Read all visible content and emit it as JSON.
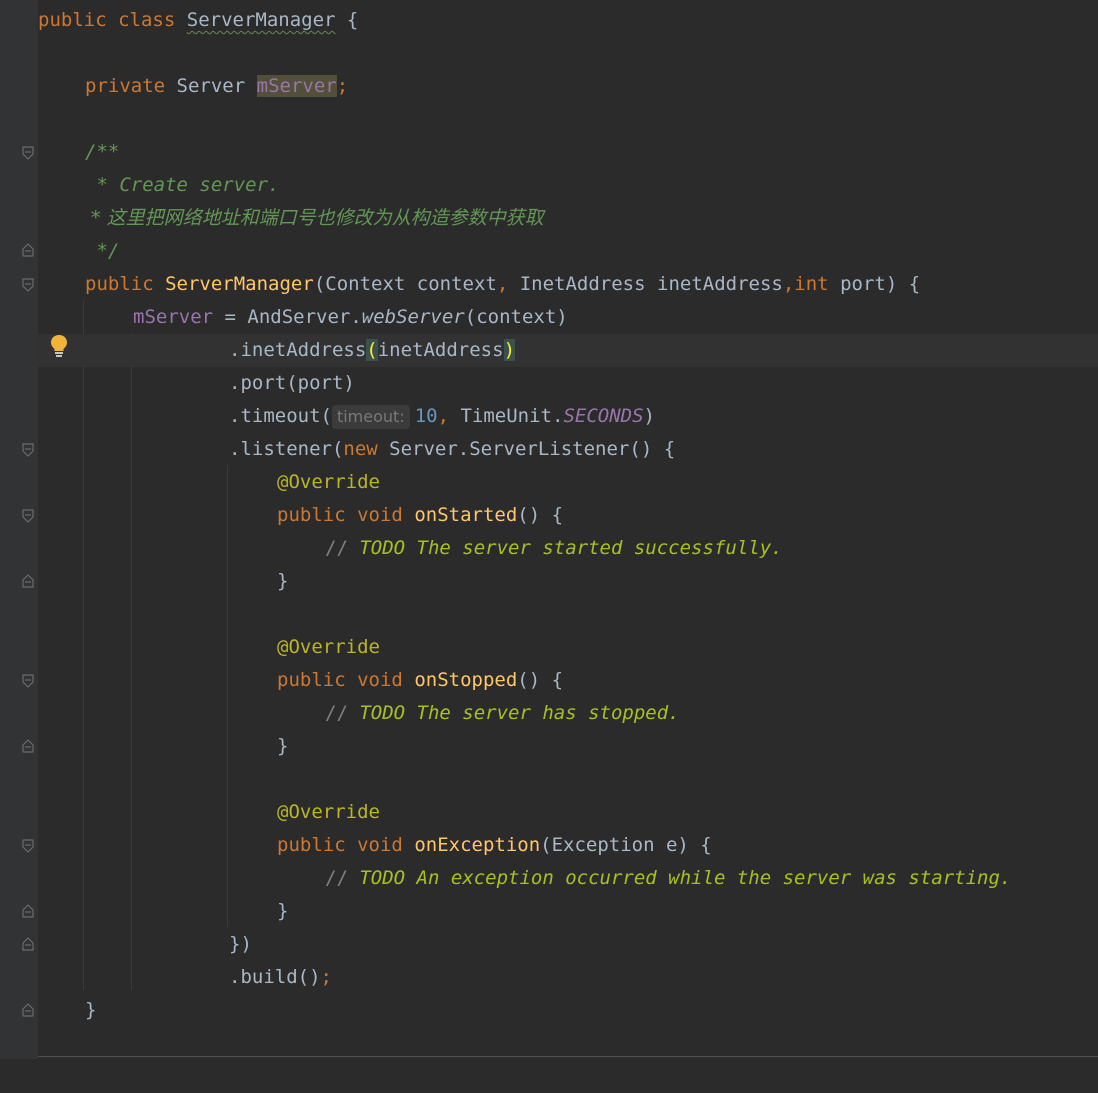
{
  "code": {
    "l01_kw1": "public",
    "l01_kw2": "class",
    "l01_name": "ServerManager",
    "l01_brace": "{",
    "l02_kw": "private",
    "l02_type": "Server",
    "l02_field": "mServer",
    "l02_semi": ";",
    "l03_open": "/**",
    "l04": " * Create server.",
    "l05": " * 这里把网络地址和端口号也修改为从构造参数中获取",
    "l06": " */",
    "l07_kw": "public",
    "l07_name": "ServerManager",
    "l07_p1": "(Context context",
    "l07_c1": ",",
    "l07_p2": " InetAddress inetAddress",
    "l07_c2": ",",
    "l07_kw2": "int",
    "l07_p3": " port) {",
    "l08_field": "mServer",
    "l08_eq": " = AndServer.",
    "l08_method": "webServer",
    "l08_rest": "(context)",
    "l09_a": ".inetAddress",
    "l09_open": "(",
    "l09_arg": "inetAddress",
    "l09_close": ")",
    "l10": ".port(port)",
    "l11_a": ".timeout(",
    "l11_hint": "timeout:",
    "l11_num": "10",
    "l11_comma": ",",
    "l11_b": " TimeUnit.",
    "l11_const": "SECONDS",
    "l11_c": ")",
    "l12_a": ".listener(",
    "l12_kw": "new",
    "l12_b": " Server.ServerListener() {",
    "override": "@Override",
    "kw_public": "public",
    "kw_void": "void",
    "l14_name": "onStarted",
    "l14_rest": "() {",
    "slashes": "//",
    "l15_todo": " TODO The server started successfully.",
    "close_brace": "}",
    "l19_name": "onStopped",
    "l19_rest": "() {",
    "l20_todo": " TODO The server has stopped.",
    "l24_name": "onException",
    "l24_rest": "(Exception e) {",
    "l25_todo": " TODO An exception occurred while the server was starting.",
    "l27": "})",
    "l28_a": ".build()",
    "l28_semi": ";",
    "l29": "}"
  },
  "colors": {
    "background": "#2b2b2b",
    "keyword": "#cc7832",
    "method": "#ffc66d",
    "field": "#9876aa",
    "comment": "#629755",
    "todo": "#a8c023",
    "annotation": "#bbb529",
    "number": "#6897bb"
  },
  "icons": {
    "intention": "lightbulb-icon",
    "fold": "fold-marker-icon"
  }
}
